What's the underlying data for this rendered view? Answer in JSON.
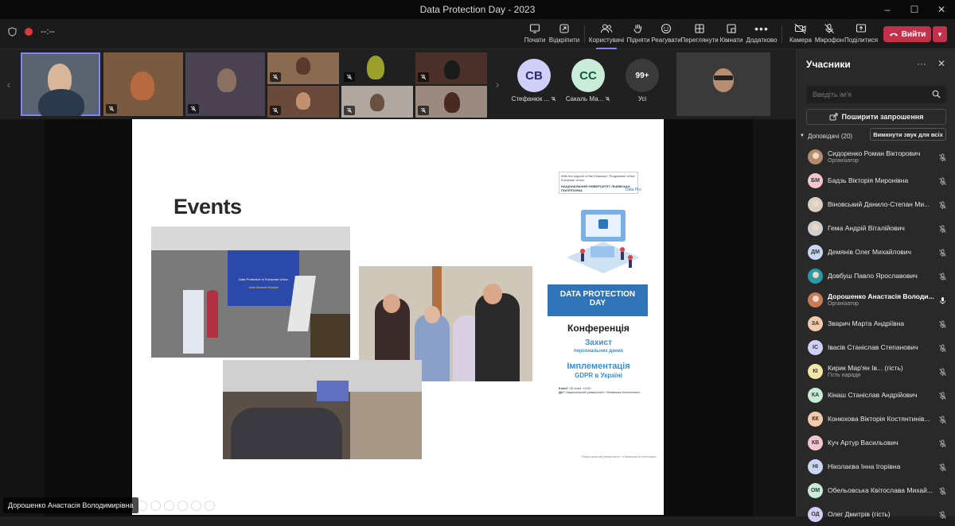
{
  "window": {
    "title": "Data Protection Day - 2023",
    "controls": [
      "–",
      "☐",
      "✕"
    ]
  },
  "toolbar": {
    "timer": "--:--",
    "items": [
      {
        "label": "Почати",
        "icon": "record-icon"
      },
      {
        "label": "Відкріпити",
        "icon": "unpin-icon"
      },
      {
        "label": "Користувачі",
        "icon": "people-icon",
        "active": true
      },
      {
        "label": "Підняти",
        "icon": "raise-hand-icon"
      },
      {
        "label": "Реагувати",
        "icon": "react-icon"
      },
      {
        "label": "Переглянути",
        "icon": "view-icon"
      },
      {
        "label": "Кімнати",
        "icon": "rooms-icon"
      },
      {
        "label": "Додатково",
        "icon": "more-icon"
      },
      {
        "label": "Камера",
        "icon": "camera-off-icon"
      },
      {
        "label": "Мікрофон",
        "icon": "mic-off-icon"
      },
      {
        "label": "Поділитися",
        "icon": "share-icon"
      }
    ],
    "leave_label": "Вийти"
  },
  "strip": {
    "avatars": [
      {
        "initials": "СВ",
        "name": "Стефанюк ...",
        "bg": "#cfcff7",
        "fg": "#2b2b6b"
      },
      {
        "initials": "СС",
        "name": "Сакаль Ма...",
        "bg": "#c9ecd9",
        "fg": "#145c37"
      },
      {
        "initials": "99+",
        "name": "Усі",
        "bg": "#3a3a3a",
        "fg": "#ffffff"
      }
    ]
  },
  "slide": {
    "title": "Events",
    "photo1_caption": "Data Protection in European Union",
    "photo1_caption2": "Jean Monnet Module",
    "poster": {
      "header": "With the support of the Erasmus+ Programme of the European Union",
      "university": "НАЦІОНАЛЬНИЙ УНІВЕРСИТЕТ ЛЬВІВСЬКА ПОЛІТЕХНІКА",
      "brand": "Data Pro",
      "band_line1": "DATA PROTECTION",
      "band_line2": "DAY",
      "conference": "Конференція",
      "topic1_line1": "Захист",
      "topic1_line2": "персональних даних",
      "topic2_line1": "Імплементація",
      "topic2_line2": "GDPR в Україні",
      "when_label": "Коли?",
      "when_value": "28 січня, 10:00",
      "where_label": "Де?",
      "where_value": "Національний університет «Львівська політехніка»"
    },
    "footer": "Національний університет «Львівська політехніка»"
  },
  "presenter_name": "Дорошенко Анастасія Володимирівна",
  "panel": {
    "title": "Учасники",
    "search_placeholder": "Введіть ім'я",
    "share_invite_label": "Поширити запрошення",
    "section_label": "Доповідачі (20)",
    "mute_all_label": "Вимкнути звук для всіх",
    "participants": [
      {
        "initials": "",
        "name": "Сидоренко Роман Вікторович",
        "role": "Організатор",
        "bg": "#b58b6e",
        "photo": true,
        "mic": "off"
      },
      {
        "initials": "БМ",
        "name": "Бадзь Вікторія Миронівна",
        "role": "",
        "bg": "#f4c6d0",
        "mic": "off"
      },
      {
        "initials": "",
        "name": "Віновський Данило-Степан Ми...",
        "role": "",
        "bg": "#d9d2c3",
        "photo": true,
        "mic": "off"
      },
      {
        "initials": "",
        "name": "Гема Андрій Віталійович",
        "role": "",
        "bg": "#cfcfcf",
        "photo": true,
        "mic": "off"
      },
      {
        "initials": "ДМ",
        "name": "Демянів Олег Михайлович",
        "role": "",
        "bg": "#c7d7f4",
        "mic": "off"
      },
      {
        "initials": "",
        "name": "Довбуш Павло Ярославович",
        "role": "",
        "bg": "#2a9aa6",
        "photo": true,
        "mic": "off"
      },
      {
        "initials": "",
        "name": "Дорошенко Анастасія Володи...",
        "role": "Організатор",
        "bg": "#c97b56",
        "photo": true,
        "mic": "on",
        "bold": true
      },
      {
        "initials": "ЗА",
        "name": "Зварич Марта Андріївна",
        "role": "",
        "bg": "#f6c9a8",
        "mic": "off"
      },
      {
        "initials": "ІС",
        "name": "Івасів Станіслав Степанович",
        "role": "",
        "bg": "#cfcff7",
        "mic": "off"
      },
      {
        "initials": "КІ",
        "name": "Кирик Мар'ян Ів... (гість)",
        "role": "Гість наради",
        "bg": "#f6e6a6",
        "mic": "off"
      },
      {
        "initials": "КА",
        "name": "Кінаш Станіслав Андрійович",
        "role": "",
        "bg": "#c9ecd9",
        "mic": "off"
      },
      {
        "initials": "КК",
        "name": "Конюхова Вікторія Костянтинів...",
        "role": "",
        "bg": "#f6c9a8",
        "mic": "off"
      },
      {
        "initials": "КВ",
        "name": "Куч Артур Васильович",
        "role": "",
        "bg": "#f4c6d0",
        "mic": "off"
      },
      {
        "initials": "НІ",
        "name": "Ніколаєва Інна Ігорівна",
        "role": "",
        "bg": "#c7d7f4",
        "mic": "off"
      },
      {
        "initials": "ОМ",
        "name": "Обельовська Квітослава Михай...",
        "role": "",
        "bg": "#c9ecd9",
        "mic": "off"
      },
      {
        "initials": "ОД",
        "name": "Олег Дмитрів (гість)",
        "role": "",
        "bg": "#cfcff7",
        "mic": "off"
      }
    ]
  }
}
